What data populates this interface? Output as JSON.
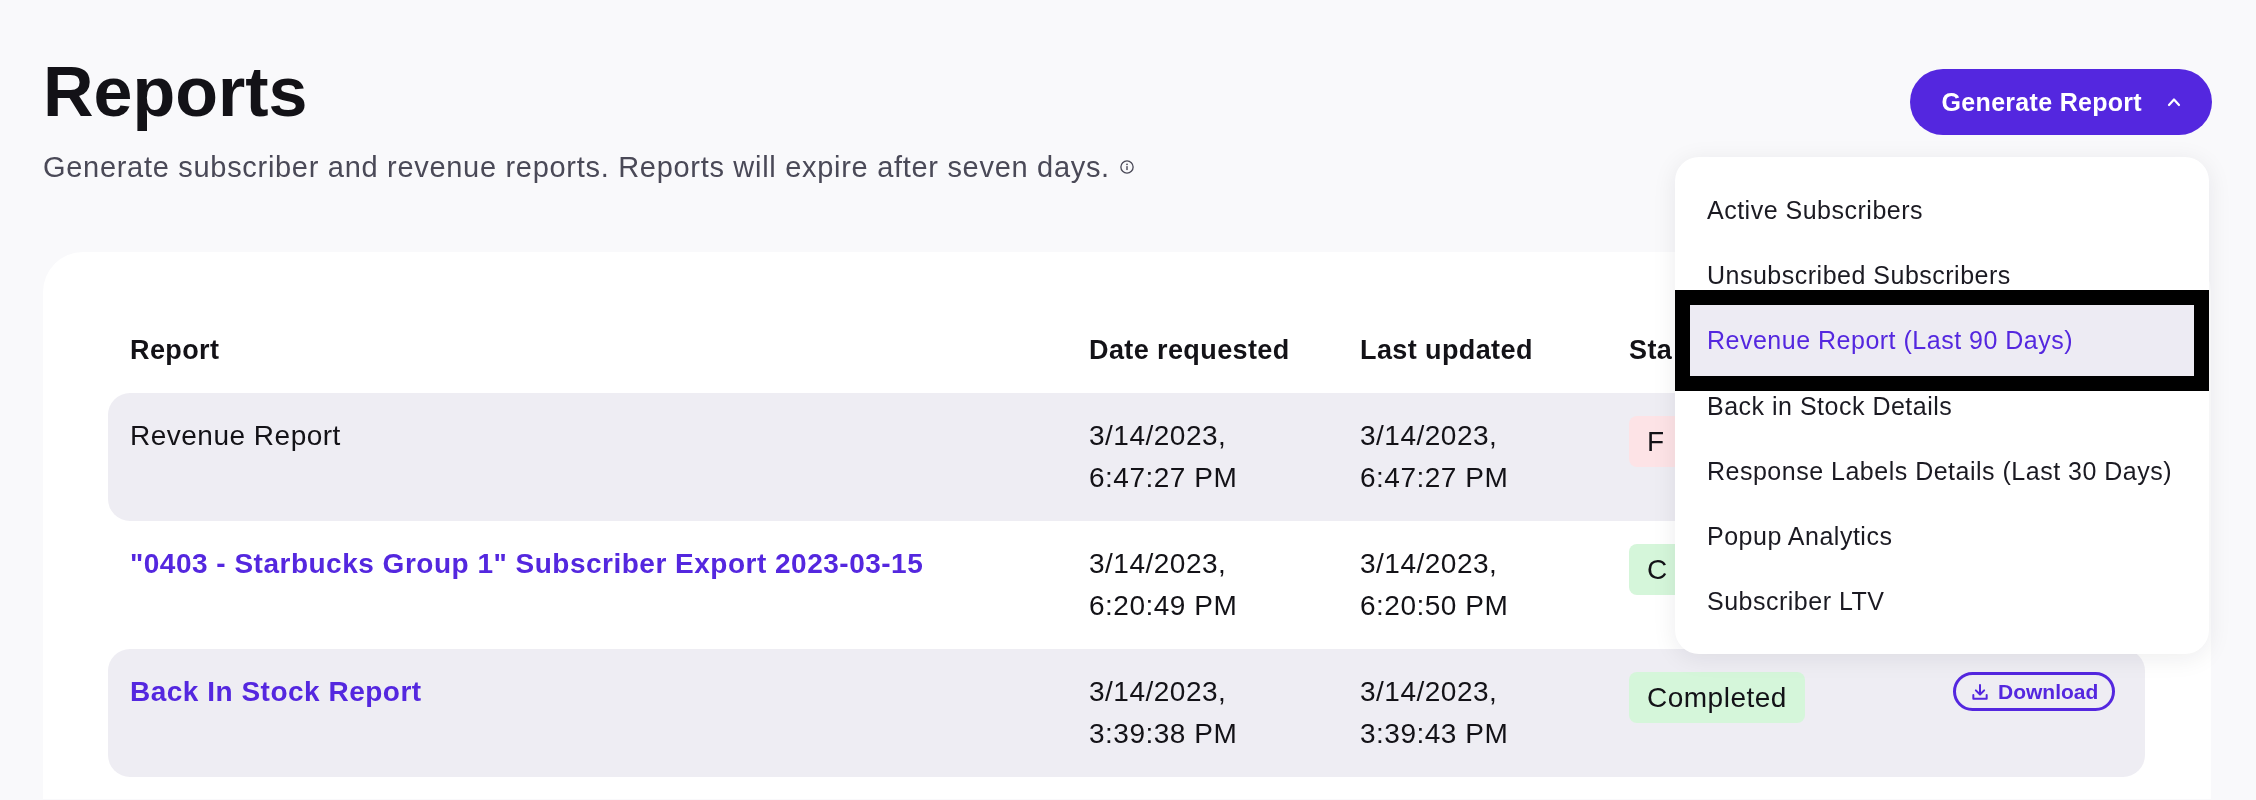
{
  "page": {
    "title": "Reports",
    "subtitle": "Generate subscriber and revenue reports. Reports will expire after seven days."
  },
  "generate_button": {
    "label": "Generate Report",
    "expanded": true
  },
  "dropdown": {
    "items": [
      {
        "label": "Active Subscribers",
        "selected": false,
        "outlined": false
      },
      {
        "label": "Unsubscribed Subscribers",
        "selected": false,
        "outlined": false
      },
      {
        "label": "Revenue Report (Last 90 Days)",
        "selected": true,
        "outlined": true
      },
      {
        "label": "Back in Stock Details",
        "selected": false,
        "outlined": false
      },
      {
        "label": "Response Labels Details (Last 30 Days)",
        "selected": false,
        "outlined": false
      },
      {
        "label": "Popup Analytics",
        "selected": false,
        "outlined": false
      },
      {
        "label": "Subscriber LTV",
        "selected": false,
        "outlined": false
      }
    ]
  },
  "table": {
    "columns": [
      "Report",
      "Date requested",
      "Last updated",
      "Sta"
    ],
    "rows": [
      {
        "report": "Revenue Report",
        "link": false,
        "date_requested": "3/14/2023, 6:47:27 PM",
        "last_updated": "3/14/2023, 6:47:27 PM",
        "status": {
          "text": "F",
          "kind": "failed"
        }
      },
      {
        "report": "\"0403 - Starbucks Group 1\" Subscriber Export 2023-03-15",
        "link": true,
        "date_requested": "3/14/2023, 6:20:49 PM",
        "last_updated": "3/14/2023, 6:20:50 PM",
        "status": {
          "text": "C",
          "kind": "completed"
        }
      },
      {
        "report": "Back In Stock Report",
        "link": true,
        "date_requested": "3/14/2023, 3:39:38 PM",
        "last_updated": "3/14/2023, 3:39:43 PM",
        "status": {
          "text": "Completed",
          "kind": "completed"
        },
        "action": "Download"
      }
    ]
  }
}
